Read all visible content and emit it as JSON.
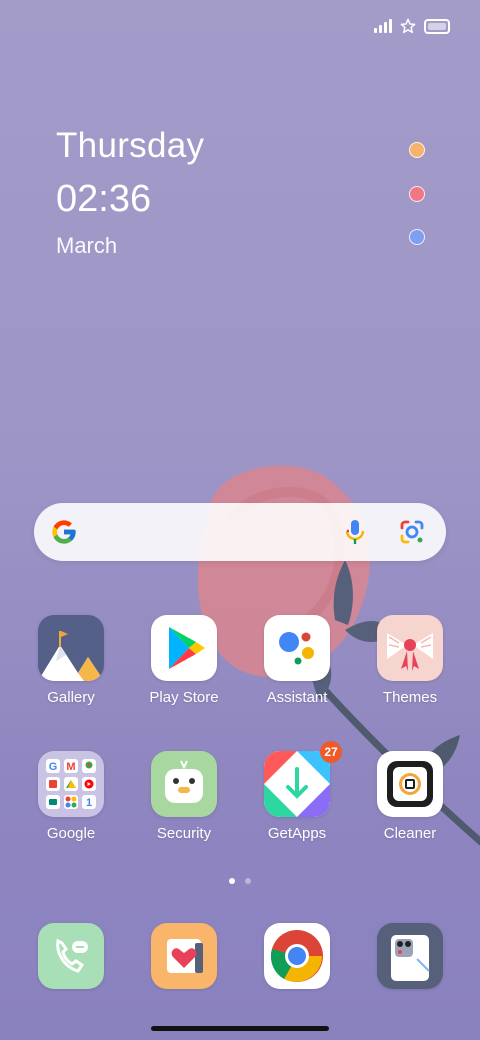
{
  "status_bar": {
    "signal_icon": "signal-icon",
    "star_icon": "star-icon",
    "battery_icon": "battery-icon"
  },
  "clock_widget": {
    "day": "Thursday",
    "time": "02:36",
    "month": "March"
  },
  "indicator_dots": {
    "colors": [
      "#f5b36d",
      "#f07884",
      "#7f9ff0"
    ]
  },
  "search_bar": {
    "google_logo": "google-logo-icon",
    "mic_icon": "mic-icon",
    "lens_icon": "lens-icon"
  },
  "apps_row1": [
    {
      "label": "Gallery",
      "icon": "gallery-icon"
    },
    {
      "label": "Play Store",
      "icon": "play-store-icon"
    },
    {
      "label": "Assistant",
      "icon": "assistant-icon"
    },
    {
      "label": "Themes",
      "icon": "themes-icon"
    }
  ],
  "apps_row2": [
    {
      "label": "Google",
      "icon": "google-folder-icon"
    },
    {
      "label": "Security",
      "icon": "security-icon"
    },
    {
      "label": "GetApps",
      "icon": "getapps-icon",
      "badge": "27"
    },
    {
      "label": "Cleaner",
      "icon": "cleaner-icon"
    }
  ],
  "dock": [
    {
      "icon": "phone-icon"
    },
    {
      "icon": "notes-icon"
    },
    {
      "icon": "chrome-icon"
    },
    {
      "icon": "camera-icon"
    }
  ],
  "pager": {
    "pages": 2,
    "active": 1
  },
  "colors": {
    "badge": "#f05a28",
    "search_bg": "#ffffff"
  }
}
